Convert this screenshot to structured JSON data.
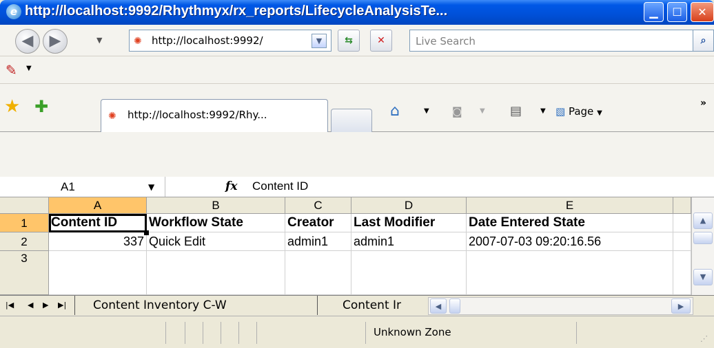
{
  "window": {
    "title": "http://localhost:9992/Rhythmyx/rx_reports/LifecycleAnalysisTe...",
    "minimize_icon": "minimize-icon",
    "maximize_icon": "maximize-icon",
    "close_icon": "close-icon"
  },
  "nav": {
    "back_icon": "back-arrow-icon",
    "forward_icon": "forward-arrow-icon",
    "address": "http://localhost:9992/",
    "refresh_icon": "refresh-icon",
    "stop_icon": "stop-icon",
    "search_placeholder": "Live Search"
  },
  "tab": {
    "label": "http://localhost:9992/Rhy...",
    "page_menu": "Page"
  },
  "formula_bar": {
    "cell_ref": "A1",
    "fx": "fx",
    "content": "Content ID"
  },
  "sheet": {
    "columns": [
      "A",
      "B",
      "C",
      "D",
      "E"
    ],
    "rows": [
      "1",
      "2",
      "3"
    ],
    "data": [
      [
        "Content ID",
        "Workflow State",
        "Creator",
        "Last Modifier",
        "Date Entered State"
      ],
      [
        "337",
        "Quick Edit",
        "admin1",
        "admin1",
        "2007-07-03 09:20:16.56"
      ]
    ]
  },
  "sheet_tabs": [
    "Content Inventory C-W",
    "Content Ir"
  ],
  "status": {
    "zone": "Unknown Zone"
  },
  "colors": {
    "titlebar": "#0050d8",
    "selected_header": "#ffc56a",
    "chrome": "#ece9d8"
  }
}
